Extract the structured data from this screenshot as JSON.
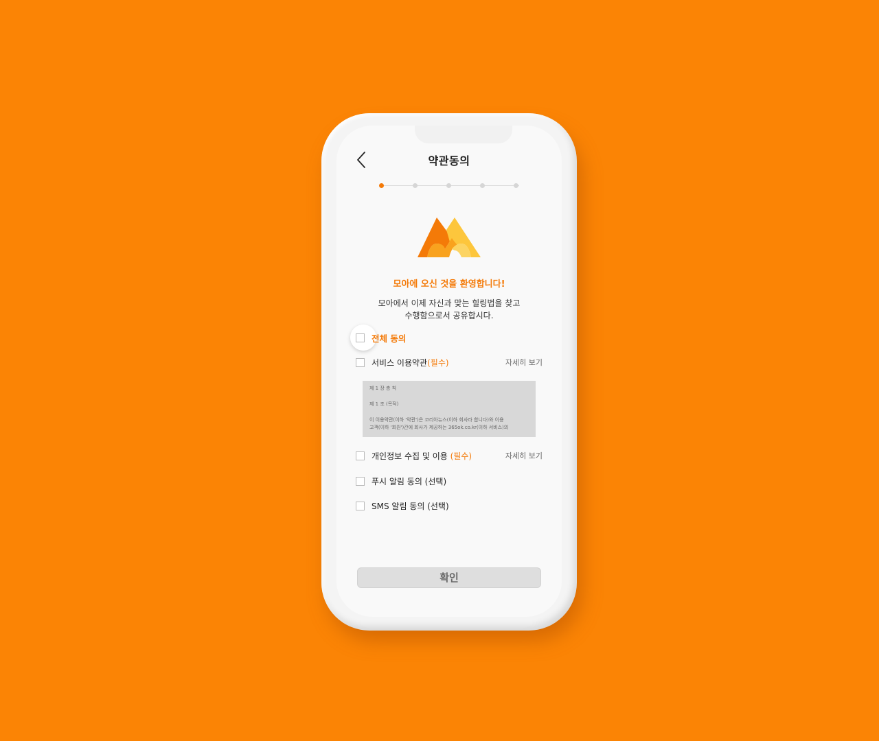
{
  "header": {
    "title": "약관동의",
    "back_icon": "chevron-left-icon"
  },
  "stepper": {
    "total_steps": 5,
    "current_step": 1
  },
  "logo": {
    "name": "moa-logo",
    "colors": [
      "#f47a08",
      "#f9b233",
      "#fdd36a"
    ]
  },
  "welcome": {
    "heading": "모아에 오신 것을 환영합니다!",
    "lines": [
      "모아에서 이제 자신과 맞는 힐링법을 찾고",
      "수행함으로서 공유합시다."
    ]
  },
  "agreements": {
    "all_label": "전체 동의",
    "service": {
      "label": "서비스 이용약관",
      "required_tag": "(필수)",
      "detail_link": "자세히 보기",
      "checked": false
    },
    "privacy": {
      "label": "개인정보 수집 및 이용 ",
      "required_tag": "(필수)",
      "detail_link": "자세히 보기",
      "checked": false
    },
    "push": {
      "label": "푸시 알림 동의 (선택)",
      "checked": false
    },
    "sms": {
      "label": "SMS 알림 동의 (선택)",
      "checked": false
    }
  },
  "terms_preview": {
    "chapter": "제 1 장 총 칙",
    "article": "제 1 조 (목적)",
    "line1": "이 이용약관(이하 '약관')은 코리아뉴스(이하 회사라 합니다)와 이용",
    "line2": "고객(이하 '회원')간에 회사가 제공하는 365ok.co.kr(이하 서비스)의"
  },
  "confirm_button": {
    "label": "확인",
    "enabled": false
  },
  "colors": {
    "background": "#fb8405",
    "accent": "#f47a08",
    "button_disabled": "#dedede"
  }
}
